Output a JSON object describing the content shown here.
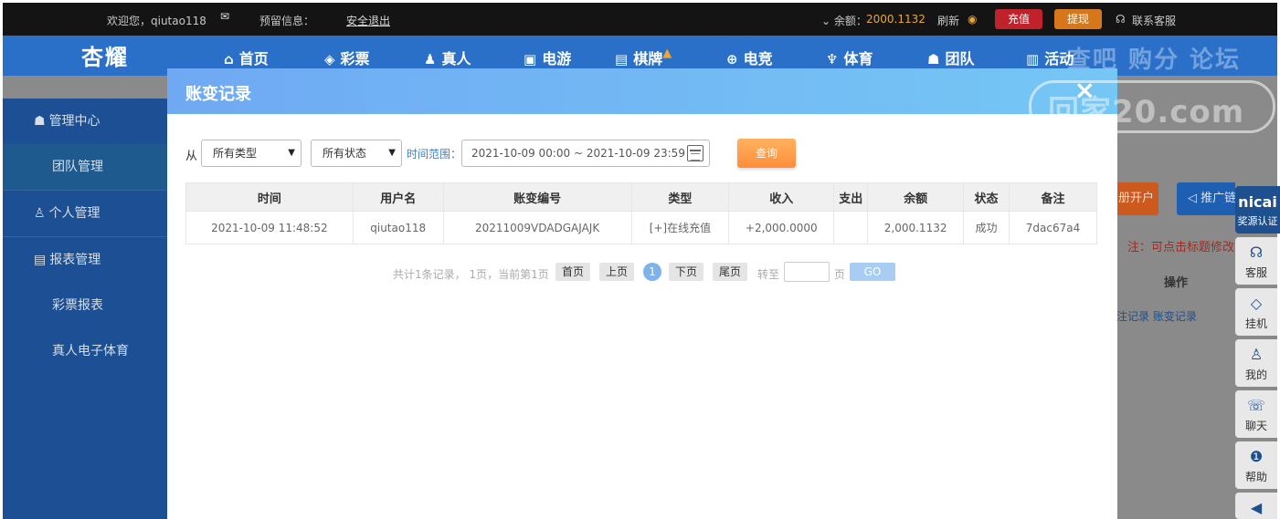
{
  "topbar": {
    "welcome": "欢迎您，qiutao118",
    "reserved_info": "预留信息：",
    "logout": "安全退出",
    "balance_label": "⌄ 余额：",
    "balance_value": "2000.1132",
    "refresh": "刷新",
    "recharge": "充值",
    "withdraw": "提现",
    "support": "联系客服"
  },
  "navbar": {
    "logo": "杏耀",
    "items": [
      "首页",
      "彩票",
      "真人",
      "电游",
      "棋牌",
      "电竞",
      "体育",
      "团队",
      "活动"
    ],
    "watermark": "查吧 购分 论坛"
  },
  "sidebar": {
    "items": [
      {
        "label": "管理中心",
        "type": "head"
      },
      {
        "label": "团队管理",
        "type": "sub"
      },
      {
        "label": "个人管理",
        "type": "head"
      },
      {
        "label": "报表管理",
        "type": "head"
      },
      {
        "label": "彩票报表",
        "type": "sub"
      },
      {
        "label": "真人电子体育",
        "type": "sub"
      }
    ]
  },
  "right_panel": {
    "btn1": "册开户",
    "btn2": "推广链",
    "note": "注：可点击标题修改",
    "op_header": "操作",
    "links": "注记录  账变记录"
  },
  "side_tools": {
    "badge_top": "nicai",
    "badge_bottom": "奖源认证",
    "items": [
      {
        "icon": "headset-icon",
        "label": "客服"
      },
      {
        "icon": "diamond-icon",
        "label": "挂机"
      },
      {
        "icon": "user-icon",
        "label": "我的"
      },
      {
        "icon": "chat-icon",
        "label": "聊天"
      },
      {
        "icon": "info-icon",
        "label": "帮助"
      }
    ]
  },
  "watermark": "回家20.com",
  "modal": {
    "title": "账变记录",
    "close": "×",
    "filter": {
      "from_label": "从",
      "type_select": "所有类型",
      "status_select": "所有状态",
      "range_label": "时间范围：",
      "range_value": "2021-10-09 00:00 ~ 2021-10-09 23:59",
      "query_button": "查询"
    },
    "table": {
      "headers": [
        "时间",
        "用户名",
        "账变编号",
        "类型",
        "收入",
        "支出",
        "余额",
        "状态",
        "备注"
      ],
      "rows": [
        [
          "2021-10-09 11:48:52",
          "qiutao118",
          "20211009VDADGAJAJK",
          "[+]在线充值",
          "+2,000.0000",
          "",
          "2,000.1132",
          "成功",
          "7dac67a4"
        ]
      ]
    },
    "pager": {
      "info": "共计1条记录， 1页，当前第1页",
      "first": "首页",
      "prev": "上页",
      "current": "1",
      "next": "下页",
      "last": "尾页",
      "goto_label": "转至",
      "page_unit": "页",
      "go": "GO"
    }
  },
  "colors": {
    "topbar_bg": "#141414",
    "nav_bg": "#2a70c9",
    "modal_header_start": "#6fa9f3",
    "modal_header_end": "#75c7f5",
    "query_button": "#ff8d3a",
    "income_green": "#4f9a21"
  }
}
